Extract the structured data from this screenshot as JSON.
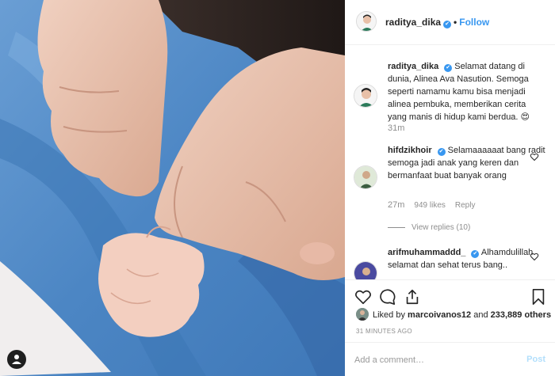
{
  "header": {
    "username": "raditya_dika",
    "verified_glyph": "✔",
    "separator": "•",
    "follow_label": "Follow"
  },
  "caption": {
    "username": "raditya_dika",
    "text": "Selamat datang di dunia, Alinea Ava Nasution. Semoga seperti namamu kamu bisa menjadi alinea pembuka, memberikan cerita yang manis di hidup kami berdua. 😍",
    "time": "31m"
  },
  "comments": [
    {
      "username": "hifdzikhoir",
      "text": "Selamaaaaaat bang radit semoga jadi anak yang keren dan bermanfaat buat banyak orang",
      "time": "27m",
      "likes": "949 likes",
      "reply_label": "Reply",
      "view_replies": "View replies (10)"
    },
    {
      "username": "arifmuhammaddd_",
      "text": "Alhamdulillah selamat dan sehat terus bang..",
      "time": ""
    }
  ],
  "likes": {
    "prefix": "Liked by",
    "user": "marcoivanos12",
    "middle": "and",
    "count": "233,889 others"
  },
  "time_ago": "31 MINUTES AGO",
  "add_comment": {
    "placeholder": "Add a comment…",
    "post_label": "Post"
  },
  "colors": {
    "accent": "#3897f0",
    "post_disabled": "#b2dffc",
    "muted": "#8e8e8e"
  },
  "icons": [
    "heart-icon",
    "comment-icon",
    "share-icon",
    "bookmark-icon",
    "user-tag-icon",
    "verified-icon"
  ]
}
